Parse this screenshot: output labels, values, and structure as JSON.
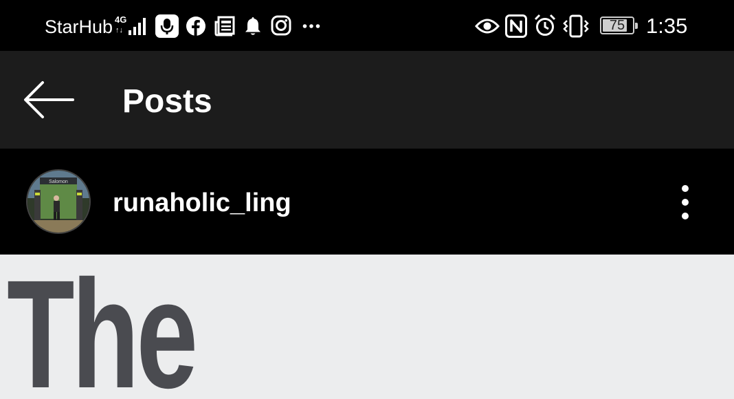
{
  "status_bar": {
    "carrier": "StarHub",
    "network": "4G",
    "battery_percent": "75",
    "time": "1:35",
    "icons": [
      "signal-icon",
      "microphone-icon",
      "facebook-icon",
      "news-icon",
      "bell-icon",
      "instagram-icon",
      "more-notifications-icon",
      "eye-icon",
      "nfc-icon",
      "alarm-icon",
      "vibrate-icon",
      "battery-icon"
    ]
  },
  "header": {
    "title": "Posts",
    "back_icon": "arrow-left-icon"
  },
  "post": {
    "username": "runaholic_ling",
    "avatar_label": "Salomon",
    "more_icon": "vertical-dots-icon",
    "image_text": "The"
  },
  "colors": {
    "header_bg": "#1c1c1c",
    "page_bg": "#000000",
    "image_bg": "#ecedee",
    "image_text": "#4a4b50"
  }
}
